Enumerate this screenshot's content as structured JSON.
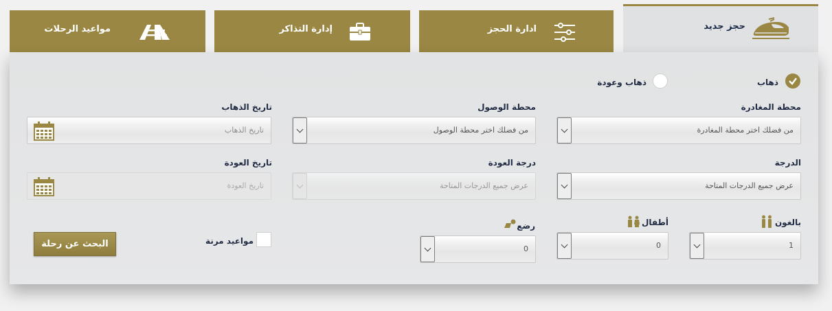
{
  "tabs": [
    {
      "label": "حجز جديد",
      "icon": "train-icon"
    },
    {
      "label": "ادارة الحجز",
      "icon": "sliders-icon"
    },
    {
      "label": "إدارة التذاكر",
      "icon": "briefcase-icon"
    },
    {
      "label": "مواعيد الرحلات",
      "icon": "railway-tracks-icon"
    }
  ],
  "trip_type": {
    "one_way": "ذهاب",
    "round_trip": "ذهاب وعودة",
    "selected": "one_way"
  },
  "departure_station": {
    "label": "محطة المغادرة",
    "value": "من فضلك اختر محطة المغادرة"
  },
  "arrival_station": {
    "label": "محطة الوصول",
    "value": "من فضلك اختر محطة الوصول"
  },
  "departure_date": {
    "label": "تاريخ الذهاب",
    "placeholder": "تاريخ الذهاب"
  },
  "class": {
    "label": "الدرجة",
    "value": "عرض جميع الدرجات المتاحة"
  },
  "return_class": {
    "label": "درجة العودة",
    "value": "عرض جميع الدرجات المتاحة"
  },
  "return_date": {
    "label": "تاريخ العودة",
    "placeholder": "تاريخ العودة"
  },
  "adults": {
    "label": "بالغون",
    "value": "1",
    "icon": "adults-icon"
  },
  "children": {
    "label": "أطفال",
    "value": "0",
    "icon": "children-icon"
  },
  "infants": {
    "label": "رضع",
    "value": "0",
    "icon": "infant-icon"
  },
  "flexible_dates": {
    "label": "مواعيد مرنة"
  },
  "search_button": {
    "label": "البحث عن رحلة"
  },
  "colors": {
    "gold": "#9a8743",
    "navy": "#222c44",
    "panel": "#e3e4e5"
  }
}
